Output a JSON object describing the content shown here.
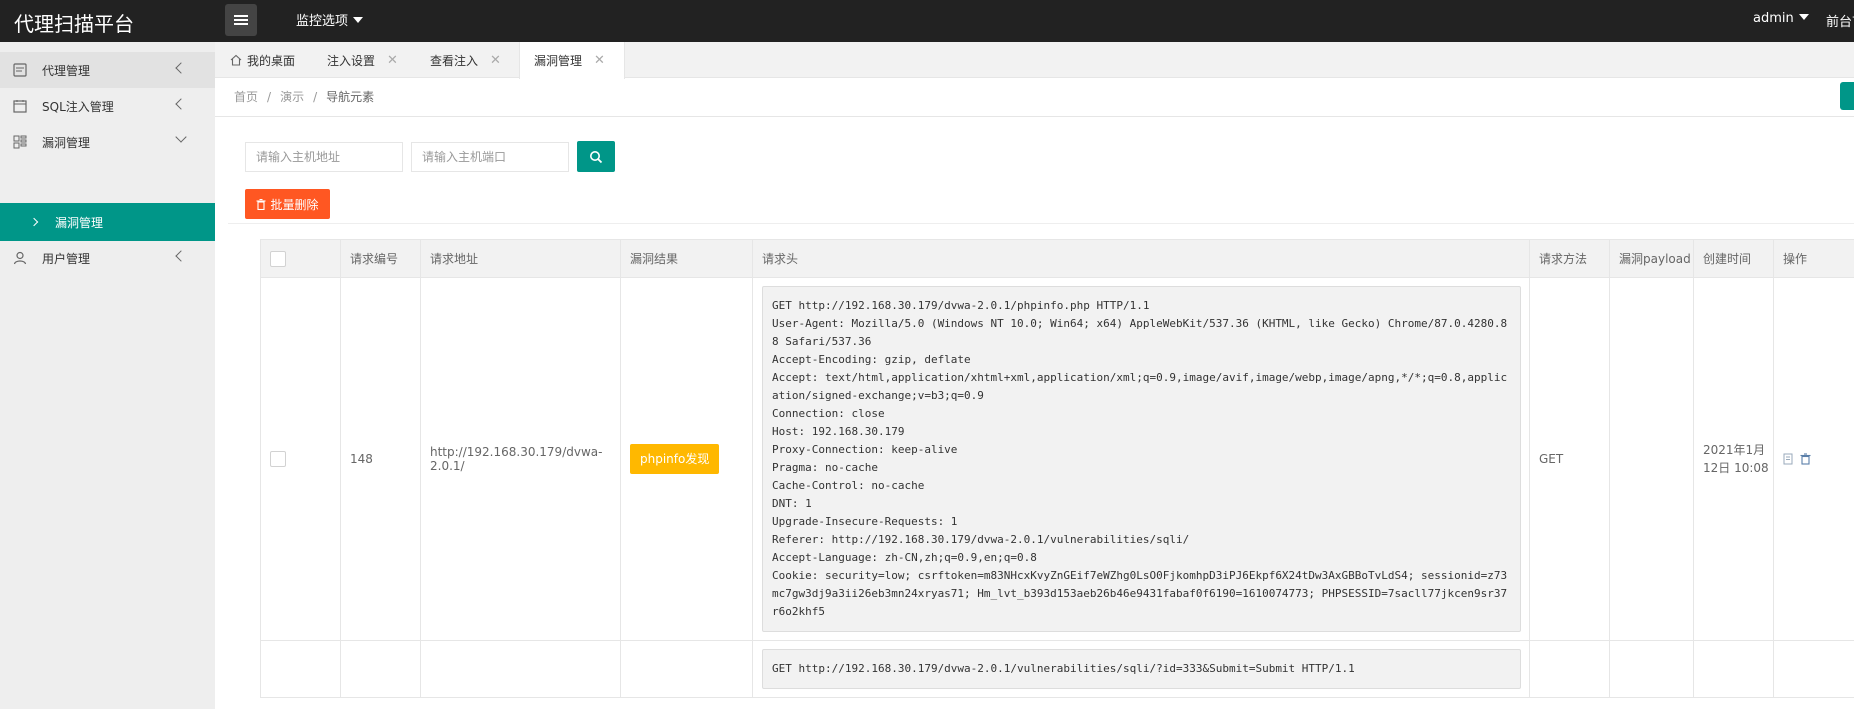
{
  "app": {
    "title": "代理扫描平台"
  },
  "header": {
    "monitor_label": "监控选项",
    "user": "admin",
    "front_label": "前台首页"
  },
  "sidebar": {
    "items": [
      {
        "label": "代理管理",
        "icon": "proxy-icon"
      },
      {
        "label": "SQL注入管理",
        "icon": "calendar-icon"
      },
      {
        "label": "漏洞管理",
        "icon": "grid-icon"
      },
      {
        "label": "漏洞管理",
        "icon": "chevron-right-icon"
      },
      {
        "label": "用户管理",
        "icon": "user-icon"
      }
    ]
  },
  "tabs": [
    {
      "label": "我的桌面",
      "closable": false
    },
    {
      "label": "注入设置",
      "closable": true
    },
    {
      "label": "查看注入",
      "closable": true
    },
    {
      "label": "漏洞管理",
      "closable": true
    }
  ],
  "breadcrumb": [
    "首页",
    "演示",
    "导航元素"
  ],
  "search": {
    "host_placeholder": "请输入主机地址",
    "port_placeholder": "请输入主机端口"
  },
  "toolbar": {
    "batch_delete_label": "批量删除"
  },
  "table": {
    "columns": [
      "",
      "请求编号",
      "请求地址",
      "漏洞结果",
      "请求头",
      "请求方法",
      "漏洞payload",
      "创建时间",
      "操作"
    ],
    "rows": [
      {
        "id": "148",
        "url": "http://192.168.30.179/dvwa-2.0.1/",
        "result": "phpinfo发现",
        "headers": "GET http://192.168.30.179/dvwa-2.0.1/phpinfo.php HTTP/1.1\nUser-Agent: Mozilla/5.0 (Windows NT 10.0; Win64; x64) AppleWebKit/537.36 (KHTML, like Gecko) Chrome/87.0.4280.88 Safari/537.36\nAccept-Encoding: gzip, deflate\nAccept: text/html,application/xhtml+xml,application/xml;q=0.9,image/avif,image/webp,image/apng,*/*;q=0.8,application/signed-exchange;v=b3;q=0.9\nConnection: close\nHost: 192.168.30.179\nProxy-Connection: keep-alive\nPragma: no-cache\nCache-Control: no-cache\nDNT: 1\nUpgrade-Insecure-Requests: 1\nReferer: http://192.168.30.179/dvwa-2.0.1/vulnerabilities/sqli/\nAccept-Language: zh-CN,zh;q=0.9,en;q=0.8\nCookie: security=low; csrftoken=m83NHcxKvyZnGEif7eWZhg0LsO0FjkomhpD3iPJ6Ekpf6X24tDw3AxGBBoTvLdS4; sessionid=z73mc7gw3dj9a3ii26eb3mn24xryas71; Hm_lvt_b393d153aeb26b46e9431fabaf0f6190=1610074773; PHPSESSID=7sacll77jkcen9sr37r6o2khf5",
        "method": "GET",
        "payload": "",
        "created": "2021年1月12日 10:08"
      },
      {
        "id": "",
        "url": "",
        "result": "",
        "headers": "GET http://192.168.30.179/dvwa-2.0.1/vulnerabilities/sqli/?id=333&Submit=Submit HTTP/1.1",
        "method": "",
        "payload": "",
        "created": ""
      }
    ]
  }
}
